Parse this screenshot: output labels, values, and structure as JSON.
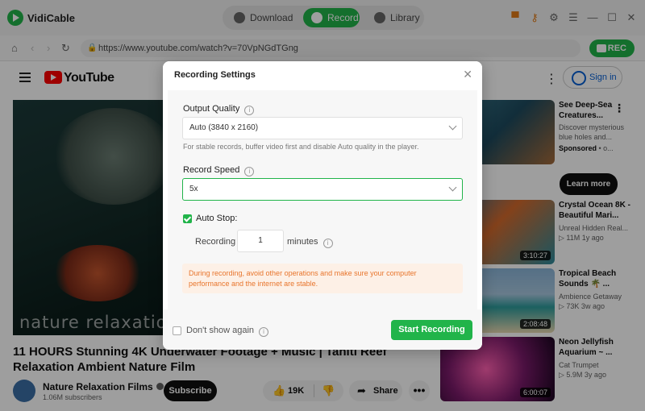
{
  "app": {
    "name": "VidiCable",
    "tabs": [
      {
        "label": "Download"
      },
      {
        "label": "Record"
      },
      {
        "label": "Library"
      }
    ]
  },
  "browser": {
    "url": "https://www.youtube.com/watch?v=70VpNGdTGng",
    "rec_label": "REC"
  },
  "youtube": {
    "logo_text": "YouTube",
    "signin_label": "Sign in",
    "watermark": "nature relaxation",
    "video_title": "11 HOURS Stunning 4K Underwater Footage + Music | Tahiti Reef Relaxation Ambient Nature Film",
    "channel_name": "Nature Relaxation Films",
    "subscribers": "1.06M subscribers",
    "subscribe_label": "Subscribe",
    "likes": "19K",
    "share_label": "Share",
    "more_label": "•••",
    "recommendations": [
      {
        "title": "See Deep-Sea Creatures...",
        "desc": "Discover mysterious blue holes and...",
        "sponsored": "Sponsored",
        "sponsored_suffix": " • o...",
        "cta": "Learn more"
      },
      {
        "title": "Crystal Ocean 8K - Beautiful Mari...",
        "channel": "Unreal Hidden Real...",
        "stats": "▷ 11M   1y ago",
        "duration": "3:10:27"
      },
      {
        "title": "Tropical Beach Sounds 🌴 ...",
        "channel": "Ambience Getaway",
        "stats": "▷ 73K   3w ago",
        "duration": "2:08:48"
      },
      {
        "title": "Neon Jellyfish Aquarium ~ ...",
        "channel": "Cat Trumpet",
        "stats": "▷ 5.9M   3y ago",
        "duration": "6:00:07"
      }
    ]
  },
  "dialog": {
    "title": "Recording Settings",
    "output_quality_label": "Output Quality",
    "output_quality_value": "Auto (3840 x 2160)",
    "hint": "For stable records, buffer video first and disable Auto quality in the player.",
    "record_speed_label": "Record Speed",
    "record_speed_value": "5x",
    "auto_stop_label": "Auto Stop:",
    "recording_label": "Recording",
    "recording_minutes": "1",
    "minutes_label": "minutes",
    "warning": "During recording, avoid other operations and make sure your computer performance and the internet are stable.",
    "dont_show_again": "Don't show again",
    "start_button": "Start Recording"
  },
  "colors": {
    "accent": "#21b44a",
    "warning_text": "#e8752c",
    "warning_bg": "#fdf0e6"
  }
}
